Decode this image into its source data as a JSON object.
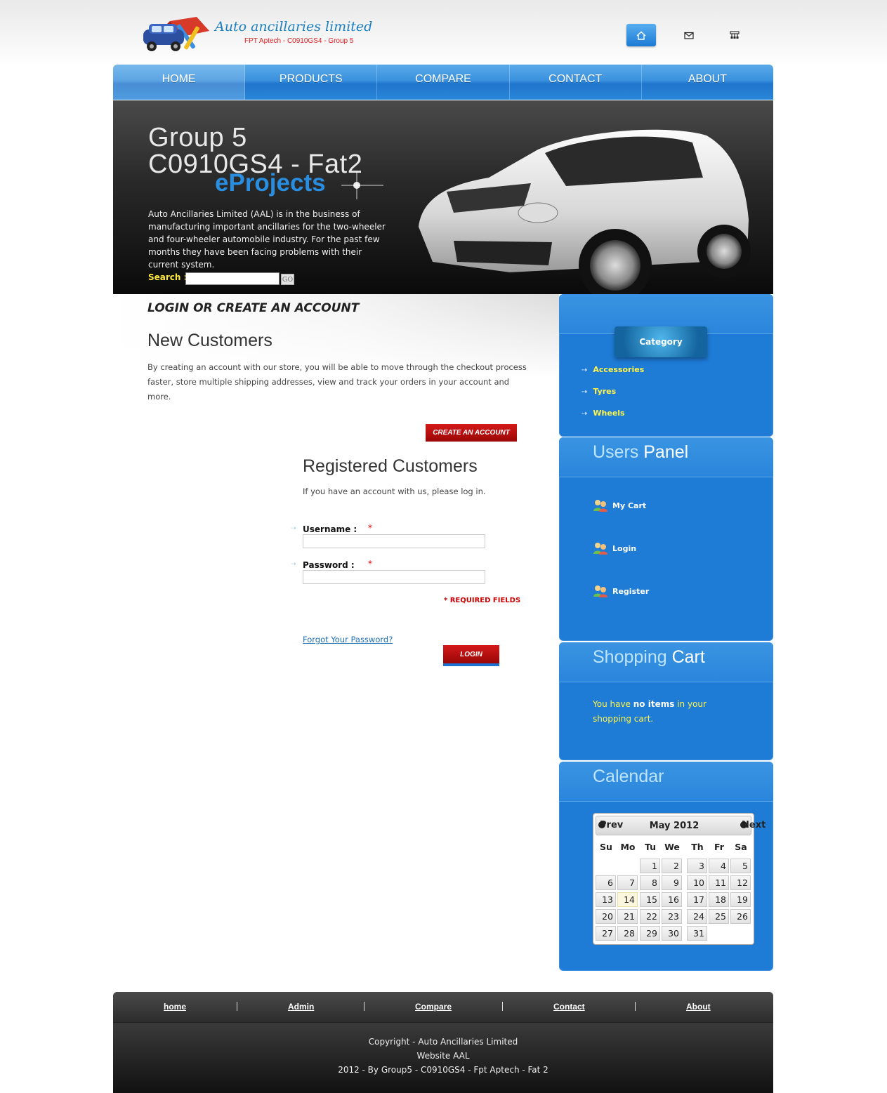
{
  "header": {
    "logo_title": "Auto ancillaries limited",
    "logo_subtitle": "FPT Aptech - C0910GS4 - Group 5",
    "icons": [
      "home-icon",
      "mail-icon",
      "sitemap-icon"
    ]
  },
  "nav": {
    "items": [
      "HOME",
      "PRODUCTS",
      "COMPARE",
      "CONTACT",
      "ABOUT"
    ]
  },
  "banner": {
    "title_line1": "Group 5",
    "title_line2": "C0910GS4 - Fat2",
    "title_line3": "eProjects",
    "description": "Auto Ancillaries Limited (AAL) is in the business of manufacturing important ancillaries for the two-wheeler and four-wheeler automobile industry. For the past few months they have been facing problems with their current system.",
    "search_label": "Search :",
    "search_value": "",
    "go_label": "GO"
  },
  "main": {
    "heading": "LOGIN OR CREATE AN ACCOUNT",
    "new_customers_title": "New Customers",
    "new_customers_text": "By creating an account with our store, you will be able to move through the checkout process faster, store multiple shipping addresses, view and track your orders in your account and more.",
    "create_account_label": "CREATE AN ACCOUNT",
    "registered_title": "Registered Customers",
    "registered_text": "If you have an account with us, please log in.",
    "username_label": "Username :",
    "password_label": "Password :",
    "required_star": "*",
    "username_value": "",
    "password_value": "",
    "required_fields": "* REQUIRED FIELDS",
    "forgot_password": "Forgot Your Password?",
    "login_label": "LOGIN"
  },
  "sidebar": {
    "category_label": "Category",
    "categories": [
      "Accessories",
      "Tyres",
      "Wheels"
    ],
    "users_panel_title_a": "Users",
    "users_panel_title_b": " Panel",
    "users_panel_items": [
      "My Cart",
      "Login",
      "Register"
    ],
    "shopping_cart_title_a": "Shopping",
    "shopping_cart_title_b": " Cart",
    "cart_text_1": "You have ",
    "cart_text_bold": "no items",
    "cart_text_2": " in your shopping cart.",
    "calendar_title_a": "Calendar",
    "calendar": {
      "prev": "Prev",
      "next": "Next",
      "month": "May 2012",
      "weekdays": [
        "Su",
        "Mo",
        "Tu",
        "We",
        "Th",
        "Fr",
        "Sa"
      ],
      "first_weekday_index": 2,
      "days_in_month": 31,
      "today": 14
    }
  },
  "footer": {
    "links": [
      "home",
      "Admin",
      "Compare",
      "Contact",
      "About"
    ],
    "line1": "Copyright - Auto Ancillaries Limited",
    "line2": "Website AAL",
    "line3": "2012 - By Group5 - C0910GS4 - Fpt Aptech - Fat 2"
  }
}
